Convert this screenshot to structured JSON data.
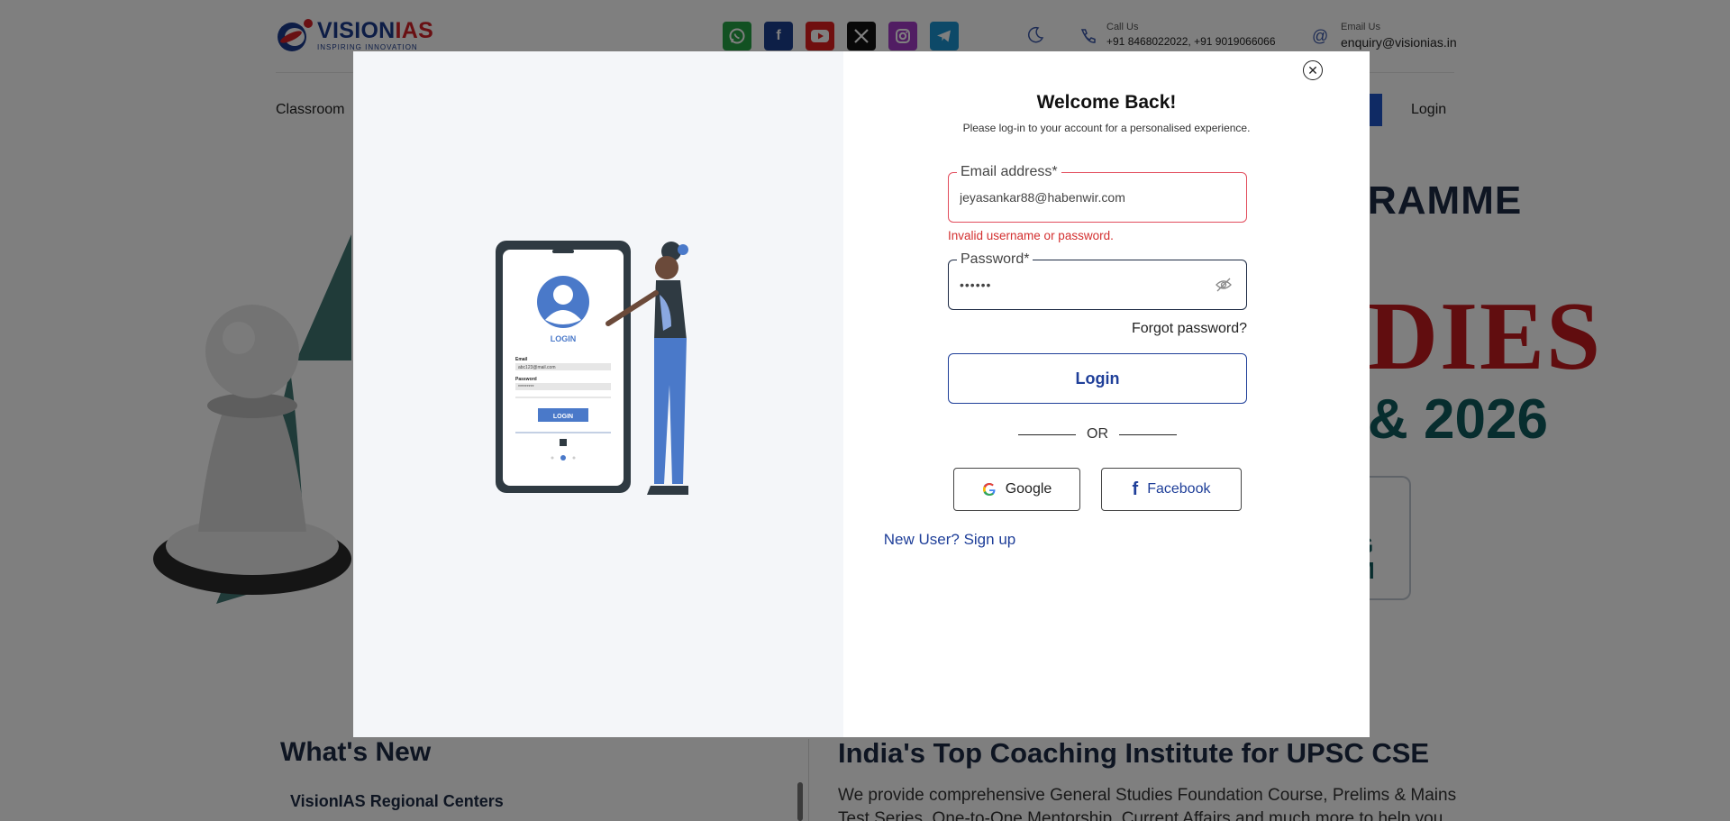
{
  "header": {
    "logo_brand_part1": "VISION",
    "logo_brand_part2": "IAS",
    "logo_tagline": "INSPIRING INNOVATION",
    "social_icons": [
      "whatsapp-icon",
      "facebook-icon",
      "youtube-icon",
      "x-icon",
      "instagram-icon",
      "telegram-icon"
    ],
    "call_label": "Call Us",
    "call_value": "+91 8468022022, +91 9019066066",
    "email_label": "Email Us",
    "email_value": "enquiry@visionias.in"
  },
  "nav": {
    "first_item": "Classroom",
    "login_label": "Login"
  },
  "hero": {
    "line1": "RAMME",
    "line2": "DIES",
    "line3": "& 2026",
    "box_line1": "G",
    "box_line2": "M"
  },
  "whats_new": {
    "title": "What's New",
    "first_item": "VisionIAS Regional Centers"
  },
  "intro": {
    "title": "India's Top Coaching Institute for UPSC CSE",
    "text": "We provide comprehensive General Studies Foundation Course, Prelims & Mains Test Series, One-to-One Mentorship, Current Affairs and much more to help you"
  },
  "modal": {
    "title": "Welcome Back!",
    "subtitle": "Please log-in to your account for a personalised experience.",
    "email_label": "Email address*",
    "email_value": "jeyasankar88@habenwir.com",
    "error_text": "Invalid username or password.",
    "password_label": "Password*",
    "password_value": "••••••",
    "forgot_label": "Forgot password?",
    "login_label": "Login",
    "or_label": "OR",
    "google_label": "Google",
    "facebook_label": "Facebook",
    "signup_label": "New User? Sign up",
    "illustration": {
      "login_heading": "LOGIN",
      "email_label": "Email",
      "email_value": "abc123@mail.com",
      "password_label": "Password",
      "password_value": "*********",
      "button_label": "LOGIN"
    }
  },
  "colors": {
    "brand_blue": "#1f3f99",
    "error_red": "#e24c5c",
    "overlay": "rgba(0,0,0,0.5)"
  }
}
